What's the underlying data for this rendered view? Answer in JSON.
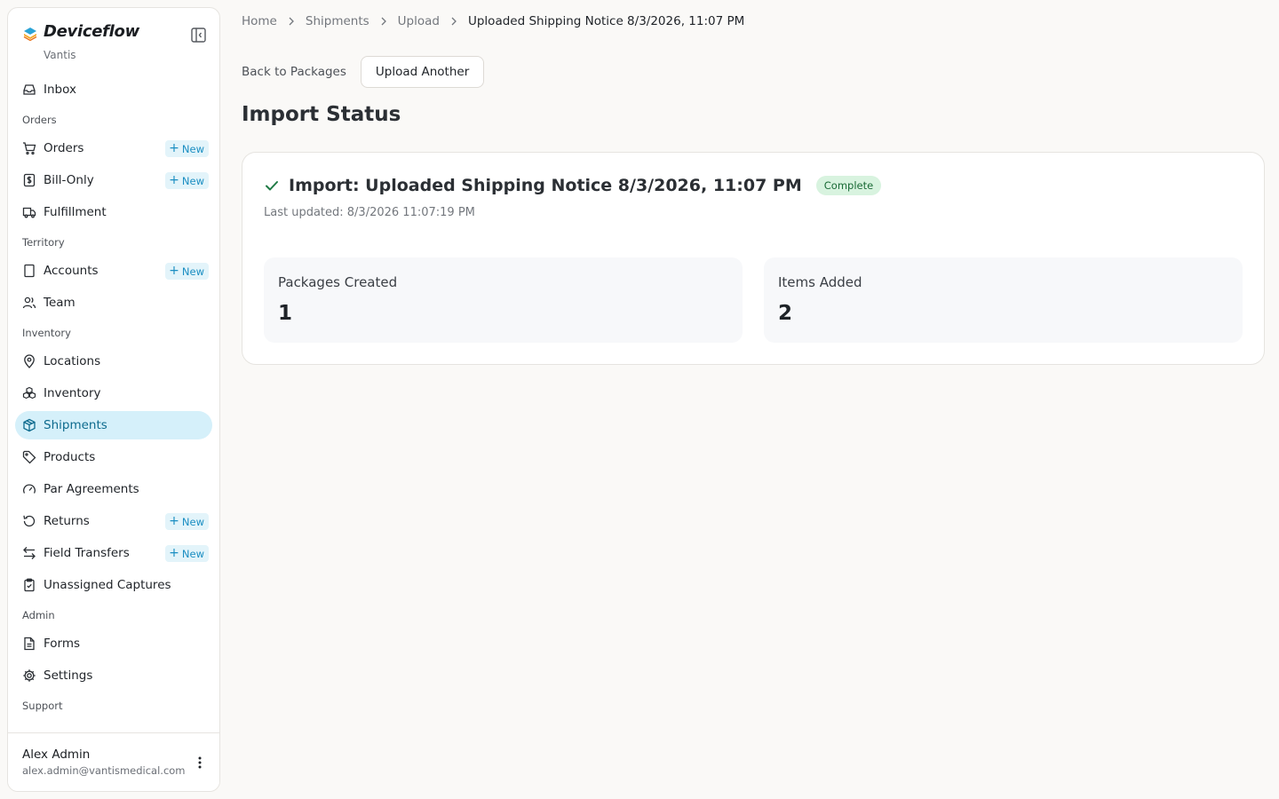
{
  "brand": {
    "name": "Deviceflow",
    "org": "Vantis"
  },
  "nav": {
    "inbox": "Inbox",
    "sections": {
      "orders": "Orders",
      "territory": "Territory",
      "inventory": "Inventory",
      "admin": "Admin",
      "support": "Support"
    },
    "items": {
      "orders": "Orders",
      "bill_only": "Bill-Only",
      "fulfillment": "Fulfillment",
      "accounts": "Accounts",
      "team": "Team",
      "locations": "Locations",
      "inventory": "Inventory",
      "shipments": "Shipments",
      "products": "Products",
      "par_agreements": "Par Agreements",
      "returns": "Returns",
      "field_transfers": "Field Transfers",
      "unassigned_captures": "Unassigned Captures",
      "forms": "Forms",
      "settings": "Settings"
    },
    "new_label": "New",
    "active": "Shipments"
  },
  "user": {
    "name": "Alex Admin",
    "email": "alex.admin@vantismedical.com"
  },
  "breadcrumb": {
    "home": "Home",
    "shipments": "Shipments",
    "upload": "Upload",
    "current": "Uploaded Shipping Notice 8/3/2026, 11:07 PM"
  },
  "actions": {
    "back": "Back to Packages",
    "upload_another": "Upload Another"
  },
  "page_title": "Import Status",
  "import": {
    "title": "Import: Uploaded Shipping Notice 8/3/2026, 11:07 PM",
    "status": "Complete",
    "last_updated": "Last updated: 8/3/2026 11:07:19 PM",
    "stats": {
      "packages_label": "Packages Created",
      "packages_value": "1",
      "items_label": "Items Added",
      "items_value": "2"
    }
  },
  "colors": {
    "accent": "#1b8ec2",
    "active_bg": "#d5f0fa",
    "success_bg": "#d8f3df",
    "success_text": "#1a6b36",
    "check": "#1f7a45"
  }
}
